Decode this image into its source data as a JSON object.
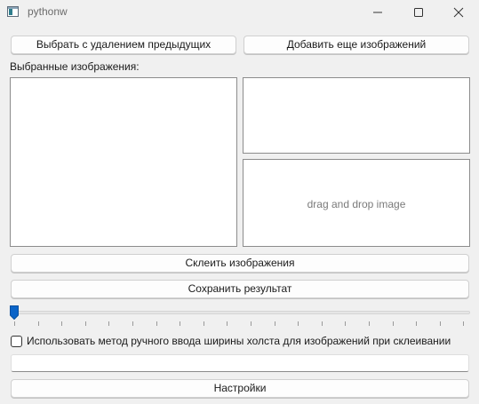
{
  "window": {
    "title": "pythonw",
    "icon": "python-app-icon",
    "controls": [
      "minimize-icon",
      "maximize-icon",
      "close-icon"
    ]
  },
  "toolbar": {
    "select_replace_label": "Выбрать с удалением предыдущих",
    "add_more_label": "Добавить еще изображений"
  },
  "selected_images_label": "Выбранные изображения:",
  "drop_zone": {
    "text": "drag and drop image"
  },
  "actions": {
    "stitch_label": "Склеить изображения",
    "save_label": "Сохранить результат",
    "settings_label": "Настройки"
  },
  "slider": {
    "value": 0,
    "accent": "#0a64c8"
  },
  "manual_width": {
    "checked": false,
    "label": "Использовать метод ручного ввода ширины холста для изображений при склеивании",
    "input_value": ""
  }
}
